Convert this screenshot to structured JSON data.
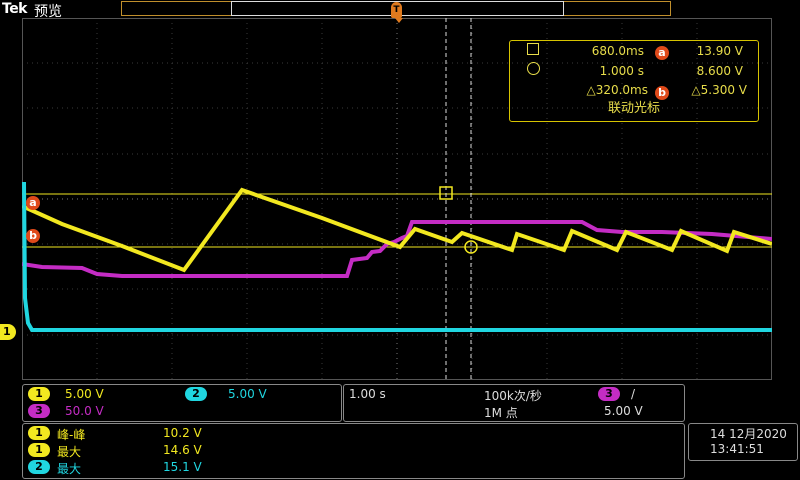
{
  "header": {
    "brand": "Tek",
    "mode": "预览"
  },
  "cursor": {
    "a_time": "680.0ms",
    "a_value": "13.90 V",
    "b_time": "1.000 s",
    "b_value": "8.600 V",
    "delta_time": "△320.0ms",
    "delta_value": "△5.300 V",
    "link_mode": "联动光标",
    "a_label": "a",
    "b_label": "b"
  },
  "markers": {
    "ch1": "1",
    "cursor_a": "a",
    "cursor_b": "b",
    "trigger": "T"
  },
  "channels": {
    "ch1": {
      "num": "1",
      "scale": "5.00 V",
      "color": "#f2e820"
    },
    "ch2": {
      "num": "2",
      "scale": "5.00 V",
      "color": "#20d6e0"
    },
    "ch3": {
      "num": "3",
      "scale": "50.0 V",
      "color": "#c42cc4"
    }
  },
  "acquisition": {
    "timebase": "1.00 s",
    "sample_rate": "100k次/秒",
    "record_length": "1M 点",
    "trigger_channel": "3",
    "trigger_slope": "/",
    "trigger_level": "5.00 V"
  },
  "measurements": [
    {
      "channel": "1",
      "name": "峰-峰",
      "value": "10.2 V"
    },
    {
      "channel": "1",
      "name": "最大",
      "value": "14.6 V"
    },
    {
      "channel": "2",
      "name": "最大",
      "value": "15.1 V"
    }
  ],
  "datetime": {
    "date": "14 12月2020",
    "time": "13:41:51"
  }
}
